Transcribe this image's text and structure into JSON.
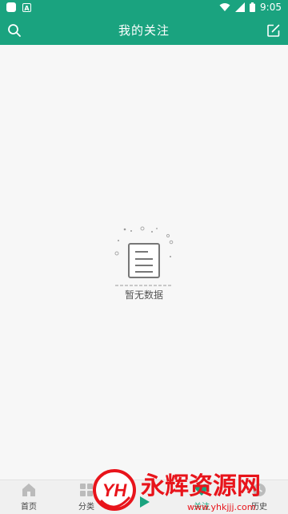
{
  "status_bar": {
    "time": "9:05",
    "icons": [
      "app-square-icon",
      "a-notification-icon",
      "wifi-icon",
      "signal-icon",
      "battery-icon"
    ]
  },
  "app_bar": {
    "title": "我的关注",
    "left_icon": "search-icon",
    "right_icon": "edit-icon"
  },
  "empty_state": {
    "message": "暂无数据",
    "icon": "empty-document-icon"
  },
  "bottom_nav": {
    "items": [
      {
        "label": "首页",
        "icon": "home-icon",
        "active": false
      },
      {
        "label": "分类",
        "icon": "category-icon",
        "active": false
      },
      {
        "label": "",
        "icon": "play-icon",
        "active": false
      },
      {
        "label": "关注",
        "icon": "follow-icon",
        "active": true
      },
      {
        "label": "历史",
        "icon": "history-icon",
        "active": false
      }
    ]
  },
  "watermark": {
    "logo_text": "YH",
    "name": "永辉资源网",
    "url": "www.yhkjjj.com"
  },
  "colors": {
    "accent": "#1aa37f",
    "watermark_red": "#e8141b"
  }
}
